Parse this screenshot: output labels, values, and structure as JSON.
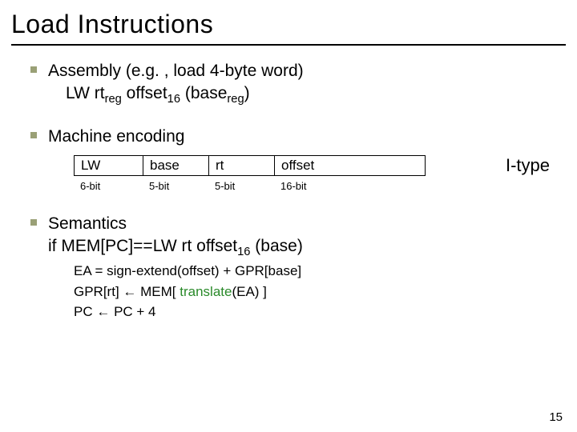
{
  "title": "Load Instructions",
  "bullet1": {
    "line1": "Assembly (e.g. , load 4-byte word)",
    "line2_pre": "LW rt",
    "line2_sub1": "reg",
    "line2_mid": " offset",
    "line2_sub2": "16",
    "line2_mid2": " (base",
    "line2_sub3": "reg",
    "line2_end": ")"
  },
  "bullet2": {
    "heading": "Machine encoding",
    "fields": {
      "f1": "LW",
      "f2": "base",
      "f3": "rt",
      "f4": "offset"
    },
    "widths": {
      "w1": "6-bit",
      "w2": "5-bit",
      "w3": "5-bit",
      "w4": "16-bit"
    },
    "type_label": "I-type"
  },
  "bullet3": {
    "heading": "Semantics",
    "cond_pre": "if MEM[PC]==LW rt offset",
    "cond_sub": "16",
    "cond_end": " (base)",
    "l1": "EA = sign-extend(offset) + GPR[base]",
    "l2_a": "GPR[rt] ",
    "l2_arrow": "←",
    "l2_b": " MEM[ ",
    "l2_green": "translate",
    "l2_c": "(EA) ]",
    "l3_a": "PC ",
    "l3_arrow": "←",
    "l3_b": " PC + 4"
  },
  "page": "15"
}
